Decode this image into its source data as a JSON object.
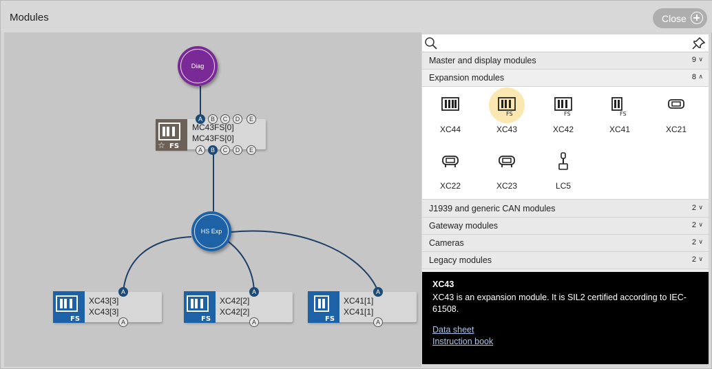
{
  "window": {
    "title": "Modules",
    "close_label": "Close"
  },
  "canvas": {
    "nodes": [
      {
        "id": "diag",
        "label": "Diag",
        "color": "#7a2a96"
      },
      {
        "id": "hsexp",
        "label": "HS Exp",
        "color": "#1d62a7"
      }
    ],
    "cards": [
      {
        "line1": "MC43FS[0]",
        "line2": "MC43FS[0]",
        "top_ports": [
          "A",
          "B",
          "C",
          "D",
          "E"
        ],
        "bottom_ports": [
          "A",
          "B",
          "C",
          "D",
          "E"
        ]
      },
      {
        "line1": "XC43[3]",
        "line2": "XC43[3]",
        "top_ports": [
          "A"
        ],
        "bottom_ports": [
          "A"
        ]
      },
      {
        "line1": "XC42[2]",
        "line2": "XC42[2]",
        "top_ports": [
          "A"
        ],
        "bottom_ports": [
          "A"
        ]
      },
      {
        "line1": "XC41[1]",
        "line2": "XC41[1]",
        "top_ports": [
          "A"
        ],
        "bottom_ports": [
          "A"
        ]
      }
    ]
  },
  "panel": {
    "search": {
      "placeholder": "",
      "value": ""
    },
    "categories": [
      {
        "label": "Master and display modules",
        "count": "9",
        "expanded": false
      },
      {
        "label": "Expansion modules",
        "count": "8",
        "expanded": true
      },
      {
        "label": "J1939 and generic CAN modules",
        "count": "2",
        "expanded": false
      },
      {
        "label": "Gateway modules",
        "count": "2",
        "expanded": false
      },
      {
        "label": "Cameras",
        "count": "2",
        "expanded": false
      },
      {
        "label": "Legacy modules",
        "count": "2",
        "expanded": false
      }
    ],
    "modules": [
      {
        "label": "XC44",
        "icon": "xc44-icon"
      },
      {
        "label": "XC43",
        "icon": "xc43-fs-icon",
        "selected": true
      },
      {
        "label": "XC42",
        "icon": "xc42-fs-icon"
      },
      {
        "label": "XC41",
        "icon": "xc41-fs-icon"
      },
      {
        "label": "XC21",
        "icon": "xc21-icon"
      },
      {
        "label": "XC22",
        "icon": "xc22-icon"
      },
      {
        "label": "XC23",
        "icon": "xc23-icon"
      },
      {
        "label": "LC5",
        "icon": "joystick-icon"
      }
    ]
  },
  "info": {
    "title": "XC43",
    "description": "XC43 is an expansion module. It is SIL2 certified according to IEC-61508.",
    "links": [
      "Data sheet",
      "Instruction book"
    ]
  },
  "colors": {
    "accent_blue": "#1d62a7",
    "port_active": "#1d4b78",
    "diag_purple": "#7a2a96",
    "selected_highlight": "#fbe7b1"
  }
}
